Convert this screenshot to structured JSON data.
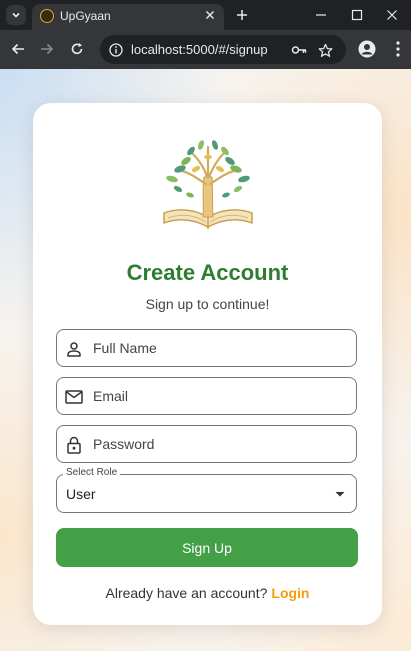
{
  "browser": {
    "tab_title": "UpGyaan",
    "url": "localhost:5000/#/signup"
  },
  "signup": {
    "title": "Create Account",
    "subtitle": "Sign up to continue!",
    "full_name_placeholder": "Full Name",
    "email_placeholder": "Email",
    "password_placeholder": "Password",
    "role_label": "Select Role",
    "role_value": "User",
    "submit_label": "Sign Up",
    "login_prompt": "Already have an account?",
    "login_link": "Login"
  },
  "colors": {
    "title_green": "#2e7d32",
    "button_green": "#43a047",
    "link_orange": "#f59e0b"
  },
  "icons": [
    "person-icon",
    "email-icon",
    "lock-icon",
    "dropdown-arrow-icon",
    "tree-book-logo"
  ]
}
